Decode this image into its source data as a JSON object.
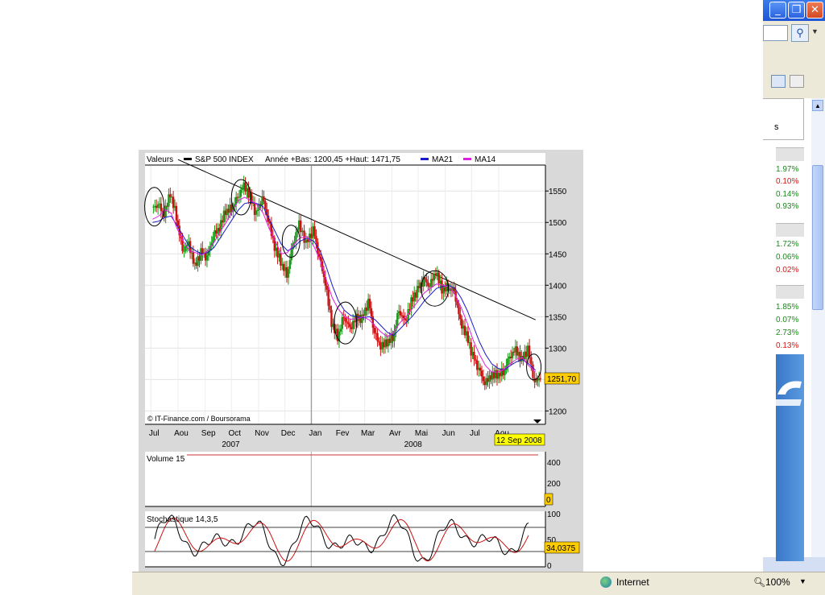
{
  "browser": {
    "status_zone": "Internet",
    "zoom": "100%",
    "window_buttons": [
      "_",
      "❐",
      "✕"
    ],
    "sidebar_fragment_text": "s",
    "sidebar_percentages": [
      {
        "value": "1.97%",
        "dir": "up"
      },
      {
        "value": "0.10%",
        "dir": "down"
      },
      {
        "value": "0.14%",
        "dir": "up"
      },
      {
        "value": "0.93%",
        "dir": "up"
      },
      {
        "value": "1.72%",
        "dir": "up"
      },
      {
        "value": "0.06%",
        "dir": "up"
      },
      {
        "value": "0.02%",
        "dir": "down"
      },
      {
        "value": "1.85%",
        "dir": "up"
      },
      {
        "value": "0.07%",
        "dir": "up"
      },
      {
        "value": "2.73%",
        "dir": "up"
      },
      {
        "value": "0.13%",
        "dir": "down"
      }
    ],
    "colors": {
      "up": "#1a8a1a",
      "down": "#d11a1a"
    }
  },
  "legend": {
    "valeurs": "Valeurs",
    "instrument": "S&P 500 INDEX",
    "range_text": "Année +Bas: 1200,45 +Haut: 1471,75",
    "ma21": "MA21",
    "ma14": "MA14",
    "colors": {
      "instrument": "#000000",
      "ma21": "#1a1acc",
      "ma14": "#e020e0"
    }
  },
  "credit": "© IT-Finance.com / Boursorama",
  "last_price_label": "1251,70",
  "date_label": "12 Sep 2008",
  "x_months": [
    "Jul",
    "Aou",
    "Sep",
    "Oct",
    "Nov",
    "Dec",
    "Jan",
    "Fev",
    "Mar",
    "Avr",
    "Mai",
    "Jun",
    "Jul",
    "Aou"
  ],
  "x_years": [
    "2007",
    "2008"
  ],
  "volume": {
    "label": "Volume 15",
    "ticks": [
      "400",
      "200"
    ],
    "last_value": "0"
  },
  "stochastic": {
    "label": "Stochastique 14,3,5",
    "ticks": [
      "100",
      "50",
      "0"
    ],
    "last_value": "34,0375"
  },
  "chart_data": {
    "type": "candlestick",
    "title": "S&P 500 INDEX",
    "period": "Jul 2007 – 12 Sep 2008",
    "ylim": [
      1180,
      1590
    ],
    "y_ticks": [
      1550,
      1500,
      1450,
      1400,
      1350,
      1300,
      1250,
      1200
    ],
    "last": 1251.7,
    "year_low": 1200.45,
    "year_high": 1471.75,
    "close_series": [
      {
        "x": "2007-07-03",
        "y": 1525
      },
      {
        "x": "2007-07-10",
        "y": 1510
      },
      {
        "x": "2007-07-17",
        "y": 1548
      },
      {
        "x": "2007-07-24",
        "y": 1512
      },
      {
        "x": "2007-07-31",
        "y": 1460
      },
      {
        "x": "2007-08-07",
        "y": 1470
      },
      {
        "x": "2007-08-14",
        "y": 1430
      },
      {
        "x": "2007-08-21",
        "y": 1450
      },
      {
        "x": "2007-08-28",
        "y": 1440
      },
      {
        "x": "2007-09-04",
        "y": 1475
      },
      {
        "x": "2007-09-11",
        "y": 1490
      },
      {
        "x": "2007-09-18",
        "y": 1520
      },
      {
        "x": "2007-09-25",
        "y": 1525
      },
      {
        "x": "2007-10-02",
        "y": 1545
      },
      {
        "x": "2007-10-09",
        "y": 1562
      },
      {
        "x": "2007-10-16",
        "y": 1540
      },
      {
        "x": "2007-10-23",
        "y": 1510
      },
      {
        "x": "2007-10-30",
        "y": 1535
      },
      {
        "x": "2007-11-06",
        "y": 1500
      },
      {
        "x": "2007-11-13",
        "y": 1460
      },
      {
        "x": "2007-11-20",
        "y": 1440
      },
      {
        "x": "2007-11-27",
        "y": 1420
      },
      {
        "x": "2007-12-04",
        "y": 1470
      },
      {
        "x": "2007-12-11",
        "y": 1500
      },
      {
        "x": "2007-12-18",
        "y": 1465
      },
      {
        "x": "2007-12-26",
        "y": 1485
      },
      {
        "x": "2008-01-03",
        "y": 1440
      },
      {
        "x": "2008-01-10",
        "y": 1400
      },
      {
        "x": "2008-01-17",
        "y": 1340
      },
      {
        "x": "2008-01-24",
        "y": 1320
      },
      {
        "x": "2008-01-31",
        "y": 1355
      },
      {
        "x": "2008-02-07",
        "y": 1335
      },
      {
        "x": "2008-02-14",
        "y": 1350
      },
      {
        "x": "2008-02-21",
        "y": 1345
      },
      {
        "x": "2008-02-28",
        "y": 1370
      },
      {
        "x": "2008-03-06",
        "y": 1320
      },
      {
        "x": "2008-03-13",
        "y": 1300
      },
      {
        "x": "2008-03-20",
        "y": 1310
      },
      {
        "x": "2008-03-27",
        "y": 1320
      },
      {
        "x": "2008-04-03",
        "y": 1365
      },
      {
        "x": "2008-04-10",
        "y": 1345
      },
      {
        "x": "2008-04-17",
        "y": 1375
      },
      {
        "x": "2008-04-24",
        "y": 1390
      },
      {
        "x": "2008-05-01",
        "y": 1405
      },
      {
        "x": "2008-05-08",
        "y": 1395
      },
      {
        "x": "2008-05-15",
        "y": 1420
      },
      {
        "x": "2008-05-22",
        "y": 1395
      },
      {
        "x": "2008-05-29",
        "y": 1400
      },
      {
        "x": "2008-06-05",
        "y": 1395
      },
      {
        "x": "2008-06-12",
        "y": 1345
      },
      {
        "x": "2008-06-19",
        "y": 1320
      },
      {
        "x": "2008-06-26",
        "y": 1285
      },
      {
        "x": "2008-07-03",
        "y": 1262
      },
      {
        "x": "2008-07-10",
        "y": 1240
      },
      {
        "x": "2008-07-17",
        "y": 1255
      },
      {
        "x": "2008-07-24",
        "y": 1260
      },
      {
        "x": "2008-07-31",
        "y": 1265
      },
      {
        "x": "2008-08-07",
        "y": 1290
      },
      {
        "x": "2008-08-14",
        "y": 1300
      },
      {
        "x": "2008-08-21",
        "y": 1280
      },
      {
        "x": "2008-08-28",
        "y": 1295
      },
      {
        "x": "2008-09-04",
        "y": 1240
      },
      {
        "x": "2008-09-12",
        "y": 1252
      }
    ],
    "ma21_series": [
      1500,
      1502,
      1508,
      1510,
      1495,
      1478,
      1462,
      1455,
      1450,
      1452,
      1460,
      1475,
      1490,
      1505,
      1520,
      1530,
      1532,
      1530,
      1525,
      1505,
      1485,
      1465,
      1455,
      1460,
      1470,
      1475,
      1470,
      1455,
      1430,
      1400,
      1375,
      1360,
      1352,
      1350,
      1348,
      1350,
      1345,
      1335,
      1325,
      1320,
      1330,
      1340,
      1350,
      1362,
      1375,
      1385,
      1395,
      1398,
      1400,
      1395,
      1380,
      1360,
      1335,
      1310,
      1290,
      1275,
      1268,
      1265,
      1272,
      1278,
      1282,
      1275,
      1265
    ],
    "ma14_series": [
      1505,
      1510,
      1520,
      1515,
      1490,
      1470,
      1455,
      1452,
      1448,
      1455,
      1468,
      1485,
      1500,
      1518,
      1535,
      1540,
      1535,
      1528,
      1515,
      1490,
      1470,
      1450,
      1452,
      1465,
      1475,
      1478,
      1462,
      1440,
      1410,
      1380,
      1362,
      1350,
      1346,
      1346,
      1350,
      1345,
      1335,
      1325,
      1318,
      1325,
      1340,
      1350,
      1362,
      1375,
      1388,
      1395,
      1402,
      1400,
      1398,
      1385,
      1365,
      1340,
      1312,
      1290,
      1272,
      1262,
      1262,
      1266,
      1275,
      1282,
      1285,
      1272,
      1262
    ],
    "trendline": [
      {
        "x": "2007-08-01",
        "y": 1600
      },
      {
        "x": "2008-09-12",
        "y": 1345
      }
    ],
    "annotation_circles": [
      "2007-07",
      "2007-10",
      "2007-12",
      "2008-02",
      "2008-05",
      "2008-09"
    ]
  }
}
